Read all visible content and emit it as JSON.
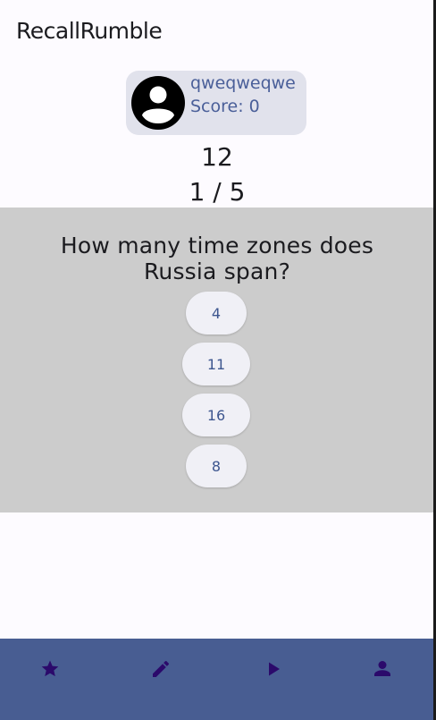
{
  "app": {
    "title": "RecallRumble"
  },
  "profile": {
    "username": "qweqweqwe",
    "score_text": "Score: 0",
    "avatar_icon": "account-circle-icon"
  },
  "quiz": {
    "timer": "12",
    "progress": "1 / 5",
    "question": "How many time zones does Russia span?",
    "answers": [
      "4",
      "11",
      "16",
      "8"
    ]
  },
  "bottom_nav": {
    "items": [
      {
        "icon": "star-icon"
      },
      {
        "icon": "pencil-icon"
      },
      {
        "icon": "play-icon"
      },
      {
        "icon": "person-icon"
      }
    ]
  },
  "colors": {
    "background": "#fdfbff",
    "profile_card": "#e1e2ec",
    "profile_text": "#4a5f99",
    "question_panel": "#cccccc",
    "answer_button": "#f0f0f6",
    "answer_text": "#3d568f",
    "bottom_nav": "#485d92",
    "nav_icon": "#2b0a6b"
  }
}
